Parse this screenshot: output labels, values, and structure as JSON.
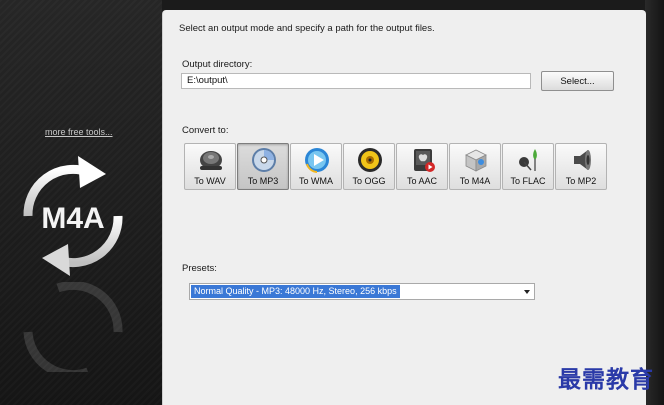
{
  "sidebar": {
    "more_tools": "more free tools...",
    "logo_text": "M4A"
  },
  "main": {
    "instruction": "Select an output mode and specify a path for the output files.",
    "output_directory": {
      "label": "Output directory:",
      "value": "E:\\output\\",
      "select_button": "Select..."
    },
    "convert": {
      "label": "Convert to:",
      "selected": "To MP3",
      "formats": [
        {
          "label": "To WAV",
          "icon": "speaker-icon"
        },
        {
          "label": "To MP3",
          "icon": "cd-disc-icon"
        },
        {
          "label": "To WMA",
          "icon": "media-player-icon"
        },
        {
          "label": "To OGG",
          "icon": "ogg-disc-icon"
        },
        {
          "label": "To AAC",
          "icon": "mac-device-icon"
        },
        {
          "label": "To M4A",
          "icon": "audio-box-icon"
        },
        {
          "label": "To FLAC",
          "icon": "headphones-icon"
        },
        {
          "label": "To MP2",
          "icon": "loudspeaker-icon"
        }
      ]
    },
    "presets": {
      "label": "Presets:",
      "value": "Normal Quality - MP3: 48000 Hz, Stereo, 256 kbps"
    }
  },
  "watermark": "最需教育",
  "colors": {
    "sidebar_bg": "#1e1e1e",
    "panel_bg": "#efefef",
    "selection": "#3a78d6",
    "watermark": "#2a3aa8"
  }
}
